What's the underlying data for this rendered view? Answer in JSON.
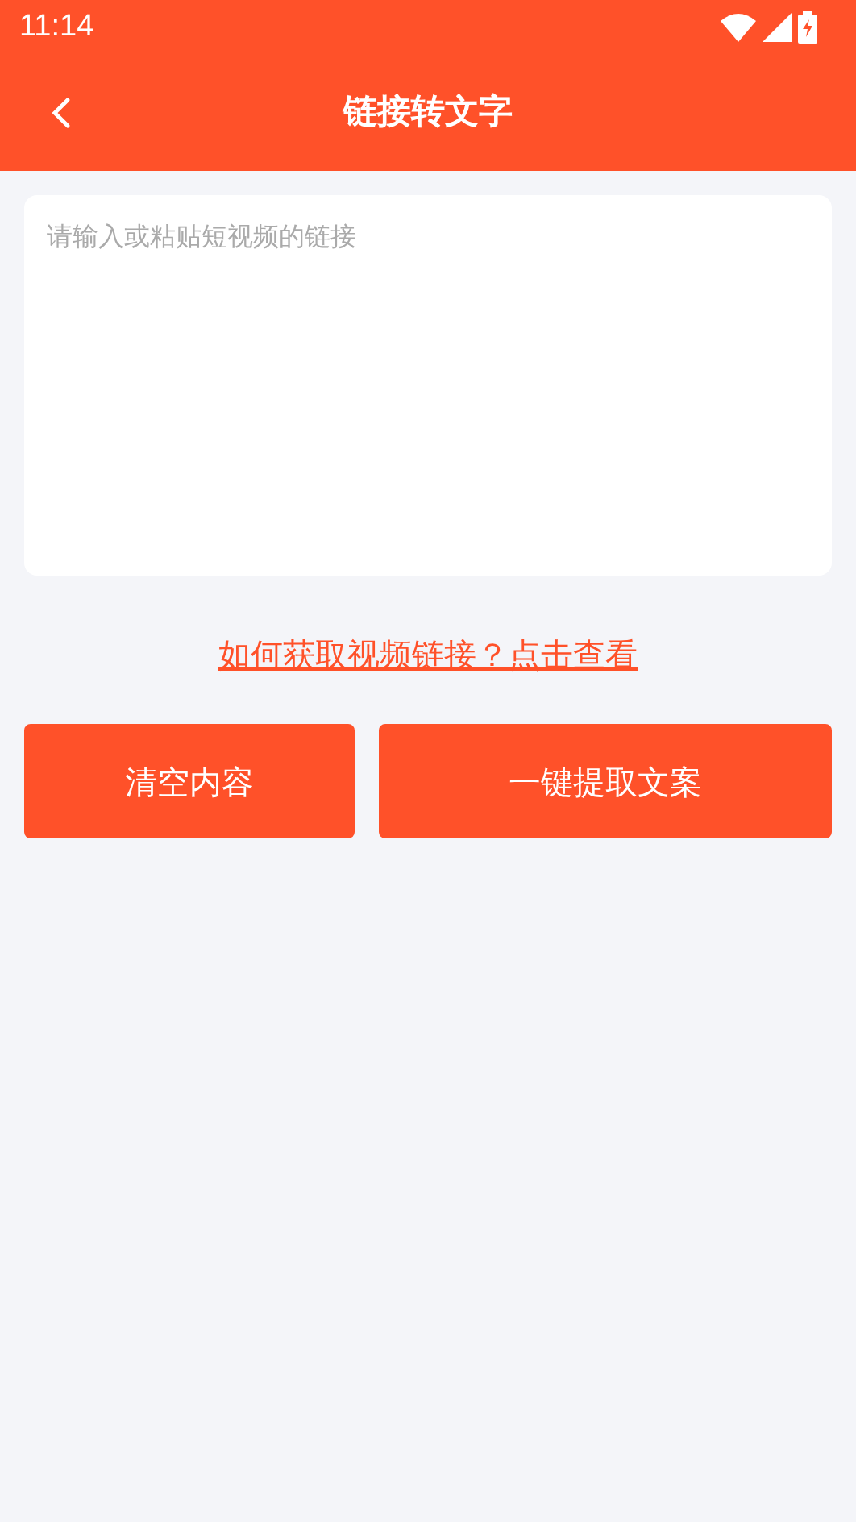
{
  "status_bar": {
    "time": "11:14"
  },
  "header": {
    "title": "链接转文字"
  },
  "link_input": {
    "placeholder": "请输入或粘贴短视频的链接"
  },
  "help_link": "如何获取视频链接？点击查看",
  "buttons": [
    "清空内容",
    "一键提取文案"
  ]
}
